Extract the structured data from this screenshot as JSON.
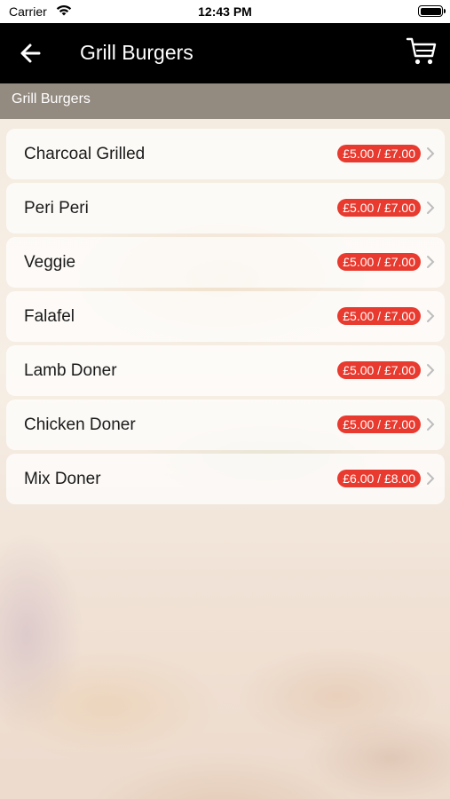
{
  "status_bar": {
    "carrier": "Carrier",
    "time": "12:43 PM",
    "wifi_icon": "wifi-icon",
    "battery_icon": "battery-icon"
  },
  "nav": {
    "title": "Grill Burgers",
    "back_icon": "back-arrow-icon",
    "cart_icon": "cart-icon"
  },
  "section": {
    "header": "Grill Burgers"
  },
  "items": [
    {
      "name": "Charcoal Grilled",
      "price": "£5.00 / £7.00"
    },
    {
      "name": "Peri Peri",
      "price": "£5.00 / £7.00"
    },
    {
      "name": "Veggie",
      "price": "£5.00 / £7.00"
    },
    {
      "name": "Falafel",
      "price": "£5.00 / £7.00"
    },
    {
      "name": "Lamb Doner",
      "price": "£5.00 / £7.00"
    },
    {
      "name": "Chicken Doner",
      "price": "£5.00 / £7.00"
    },
    {
      "name": "Mix Doner",
      "price": "£6.00 / £8.00"
    }
  ],
  "colors": {
    "nav_background": "#000000",
    "price_badge": "#e83a2e",
    "section_header": "#6e645a"
  }
}
